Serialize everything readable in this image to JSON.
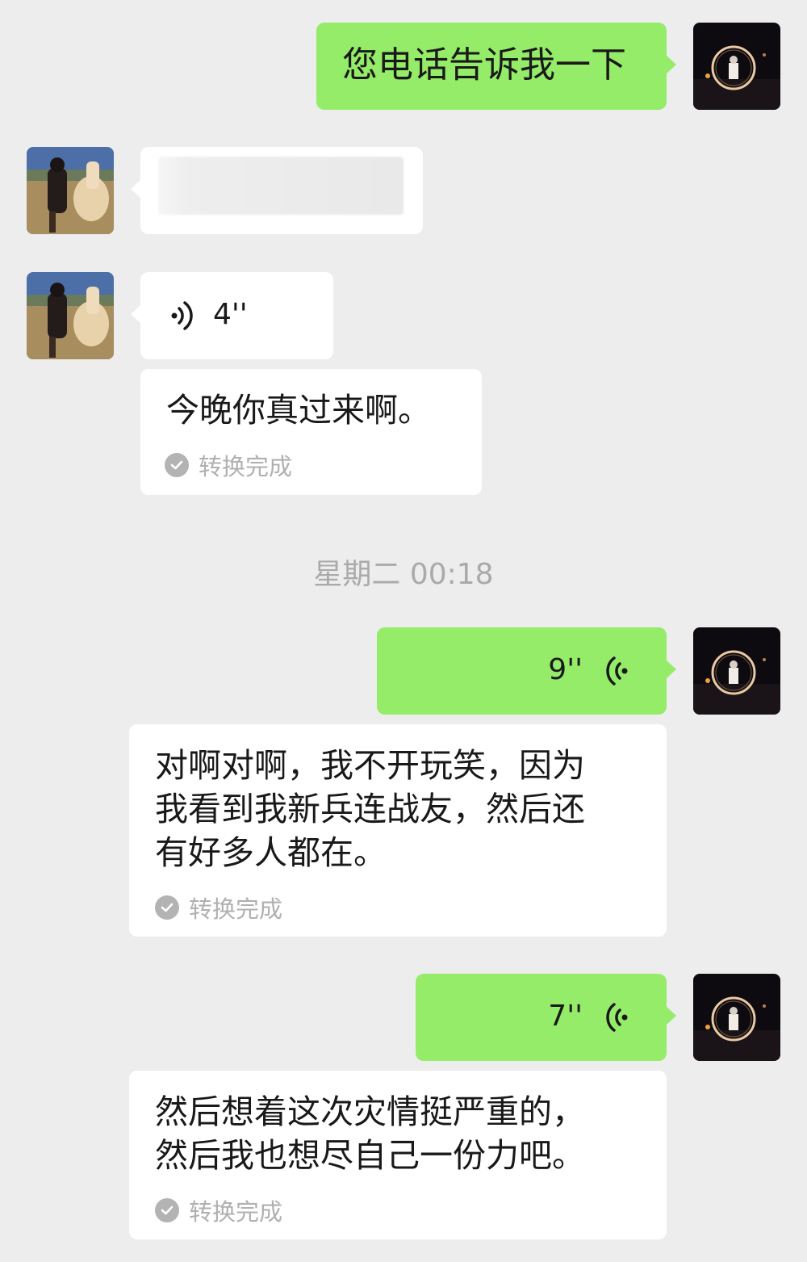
{
  "conversation": {
    "timestamp": "星期二 00:18",
    "messages": [
      {
        "id": "m1",
        "side": "me",
        "kind": "text",
        "text": "您电话告诉我一下",
        "avatar": "ring-portrait-avatar"
      },
      {
        "id": "m2",
        "side": "contact",
        "kind": "text-redacted",
        "avatar": "rider-horse-avatar"
      },
      {
        "id": "m3",
        "side": "contact",
        "kind": "voice",
        "duration": "4''",
        "avatar": "rider-horse-avatar",
        "transcript": "今晚你真过来啊。",
        "transcript_status": "转换完成"
      },
      {
        "id": "m4",
        "side": "me",
        "kind": "voice",
        "duration": "9''",
        "avatar": "ring-portrait-avatar",
        "transcript_lines": [
          "对啊对啊，我不开玩笑，因为",
          "我看到我新兵连战友，然后还",
          "有好多人都在。"
        ],
        "transcript_status": "转换完成"
      },
      {
        "id": "m5",
        "side": "me",
        "kind": "voice",
        "duration": "7''",
        "avatar": "ring-portrait-avatar",
        "transcript_lines": [
          "然后想着这次灾情挺严重的，",
          "然后我也想尽自己一份力吧。"
        ],
        "transcript_status": "转换完成"
      }
    ]
  },
  "colors": {
    "background": "#ededed",
    "bubble_me": "#95ec69",
    "bubble_contact": "#ffffff",
    "muted_text": "#aaaaaa"
  }
}
